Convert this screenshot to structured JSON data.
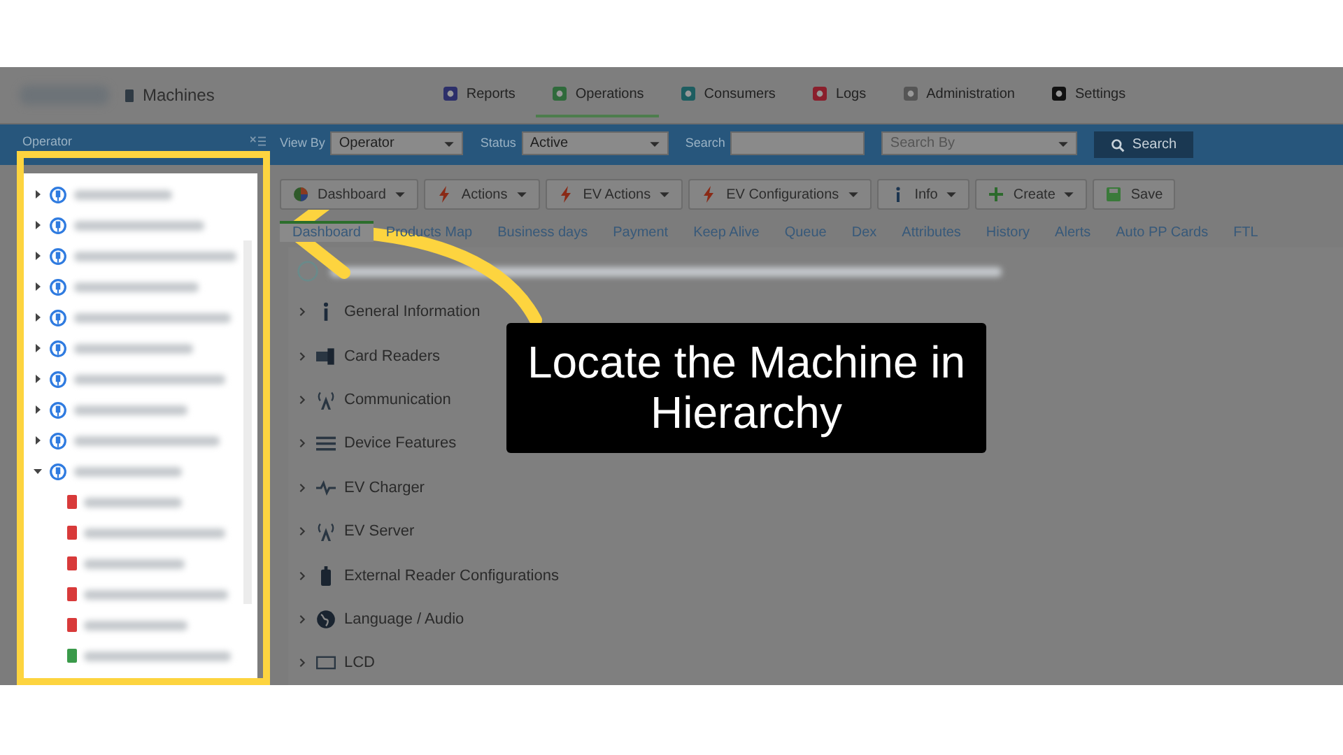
{
  "app": {
    "section": "Machines"
  },
  "nav": [
    {
      "label": "Reports",
      "kind": "reports",
      "selected": false
    },
    {
      "label": "Operations",
      "kind": "operations",
      "selected": true
    },
    {
      "label": "Consumers",
      "kind": "consumers",
      "selected": false
    },
    {
      "label": "Logs",
      "kind": "logs",
      "selected": false
    },
    {
      "label": "Administration",
      "kind": "admin",
      "selected": false
    },
    {
      "label": "Settings",
      "kind": "settings",
      "selected": false
    }
  ],
  "sidebar": {
    "title": "Operator",
    "tree": [
      {
        "expanded": false
      },
      {
        "expanded": false
      },
      {
        "expanded": false
      },
      {
        "expanded": false
      },
      {
        "expanded": false
      },
      {
        "expanded": false
      },
      {
        "expanded": false
      },
      {
        "expanded": false
      },
      {
        "expanded": false
      },
      {
        "expanded": true,
        "children": [
          {
            "color": "#d83a3a"
          },
          {
            "color": "#d83a3a"
          },
          {
            "color": "#d83a3a"
          },
          {
            "color": "#d83a3a"
          },
          {
            "color": "#d83a3a"
          },
          {
            "color": "#3a9a4a"
          }
        ]
      }
    ]
  },
  "filters": {
    "view_by": {
      "label": "View By",
      "value": "Operator"
    },
    "status": {
      "label": "Status",
      "value": "Active"
    },
    "search": {
      "label": "Search"
    },
    "search_by": {
      "placeholder": "Search By"
    },
    "button": "Search"
  },
  "toolbar": [
    {
      "label": "Dashboard",
      "kind": "pie",
      "dropdown": true
    },
    {
      "label": "Actions",
      "kind": "bolt",
      "dropdown": true
    },
    {
      "label": "EV Actions",
      "kind": "bolt",
      "dropdown": true
    },
    {
      "label": "EV Configurations",
      "kind": "bolt",
      "dropdown": true
    },
    {
      "label": "Info",
      "kind": "info",
      "dropdown": true
    },
    {
      "label": "Create",
      "kind": "plus",
      "dropdown": true
    },
    {
      "label": "Save",
      "kind": "save",
      "dropdown": false
    }
  ],
  "tabs": [
    {
      "label": "Dashboard",
      "selected": true
    },
    {
      "label": "Products Map",
      "selected": false
    },
    {
      "label": "Business days",
      "selected": false
    },
    {
      "label": "Payment",
      "selected": false
    },
    {
      "label": "Keep Alive",
      "selected": false
    },
    {
      "label": "Queue",
      "selected": false
    },
    {
      "label": "Dex",
      "selected": false
    },
    {
      "label": "Attributes",
      "selected": false
    },
    {
      "label": "History",
      "selected": false
    },
    {
      "label": "Alerts",
      "selected": false
    },
    {
      "label": "Auto PP Cards",
      "selected": false
    },
    {
      "label": "FTL",
      "selected": false
    }
  ],
  "sections": [
    {
      "label": "General Information",
      "kind": "info"
    },
    {
      "label": "Card Readers",
      "kind": "card"
    },
    {
      "label": "Communication",
      "kind": "antenna"
    },
    {
      "label": "Device Features",
      "kind": "list"
    },
    {
      "label": "EV Charger",
      "kind": "pulse"
    },
    {
      "label": "EV Server",
      "kind": "antenna"
    },
    {
      "label": "External Reader Configurations",
      "kind": "reader"
    },
    {
      "label": "Language / Audio",
      "kind": "globe"
    },
    {
      "label": "LCD",
      "kind": "lcd"
    }
  ],
  "callout": {
    "text": "Locate the Machine in Hierarchy"
  }
}
